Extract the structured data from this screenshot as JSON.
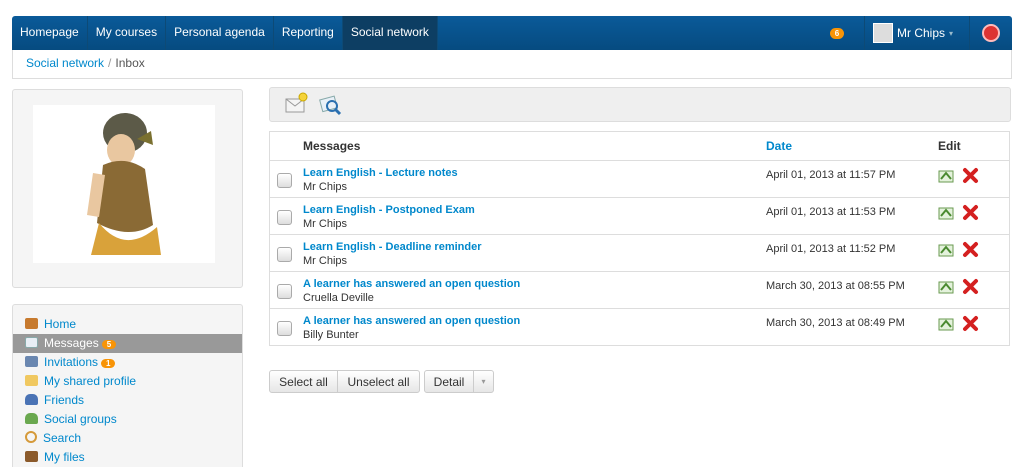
{
  "nav": {
    "items": [
      {
        "label": "Homepage"
      },
      {
        "label": "My courses"
      },
      {
        "label": "Personal agenda"
      },
      {
        "label": "Reporting"
      },
      {
        "label": "Social network"
      }
    ],
    "notification_count": "6",
    "user_name": "Mr Chips"
  },
  "breadcrumb": {
    "root": "Social network",
    "current": "Inbox"
  },
  "sidebar": {
    "items": [
      {
        "label": "Home",
        "icon": "home-icon"
      },
      {
        "label": "Messages",
        "icon": "mail-icon",
        "badge": "5"
      },
      {
        "label": "Invitations",
        "icon": "invitation-icon",
        "badge": "1"
      },
      {
        "label": "My shared profile",
        "icon": "folder-icon"
      },
      {
        "label": "Friends",
        "icon": "friend-icon"
      },
      {
        "label": "Social groups",
        "icon": "group-icon"
      },
      {
        "label": "Search",
        "icon": "search-icon"
      },
      {
        "label": "My files",
        "icon": "files-icon"
      }
    ]
  },
  "table": {
    "headers": {
      "messages": "Messages",
      "date": "Date",
      "edit": "Edit"
    },
    "rows": [
      {
        "subject": "Learn English - Lecture notes",
        "from": "Mr Chips",
        "date": "April 01, 2013 at 11:57 PM"
      },
      {
        "subject": "Learn English - Postponed Exam",
        "from": "Mr Chips",
        "date": "April 01, 2013 at 11:53 PM"
      },
      {
        "subject": "Learn English - Deadline reminder",
        "from": "Mr Chips",
        "date": "April 01, 2013 at 11:52 PM"
      },
      {
        "subject": "A learner has answered an open question",
        "from": "Cruella Deville",
        "date": "March 30, 2013 at 08:55 PM"
      },
      {
        "subject": "A learner has answered an open question",
        "from": "Billy Bunter",
        "date": "March 30, 2013 at 08:49 PM"
      }
    ]
  },
  "actions": {
    "select_all": "Select all",
    "unselect_all": "Unselect all",
    "detail": "Detail"
  },
  "colors": {
    "nav": "#0a5a99",
    "link": "#0088cc",
    "badge": "#f89406",
    "delete": "#d42020"
  }
}
